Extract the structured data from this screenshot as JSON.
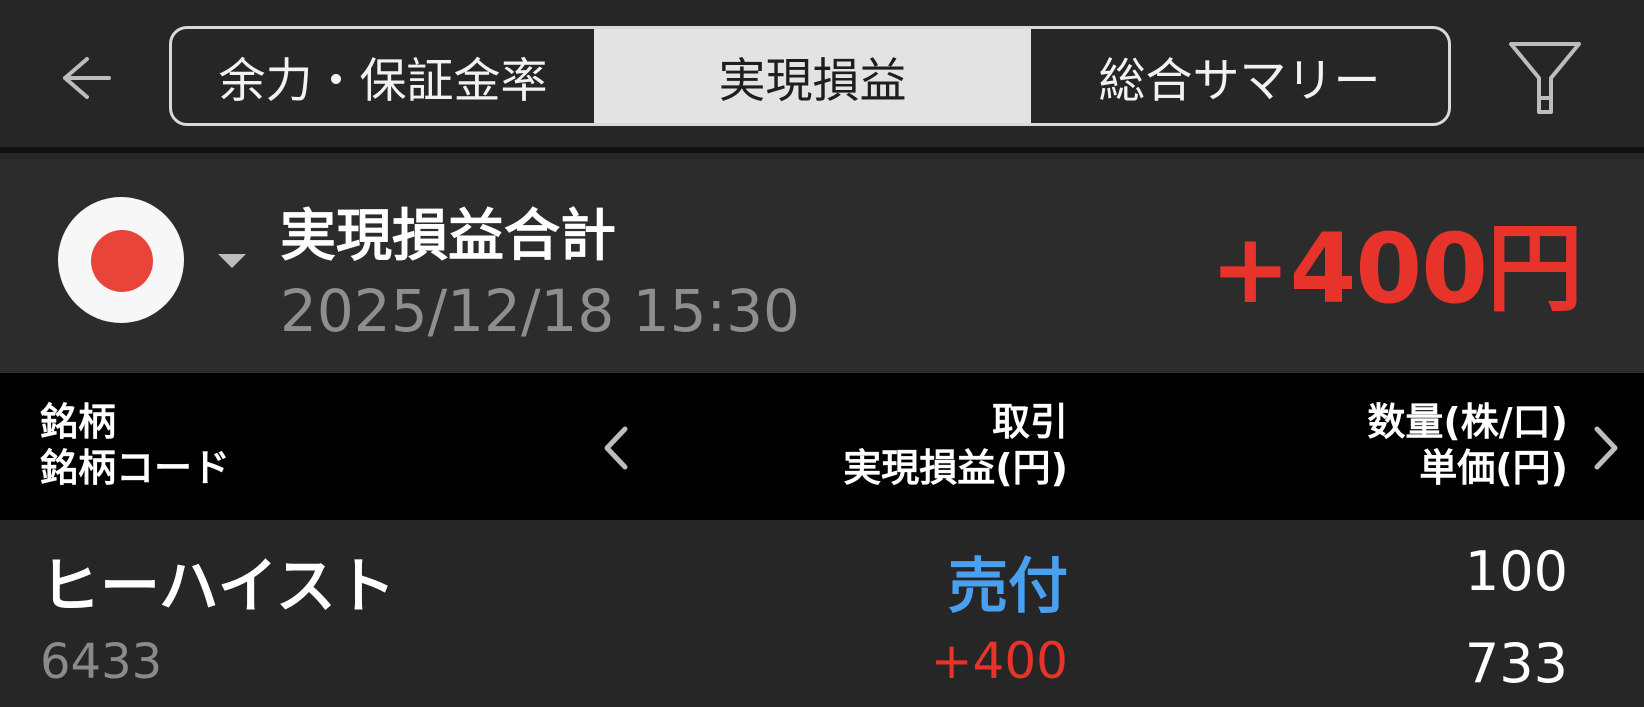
{
  "header": {
    "tabs": [
      {
        "label": "余力・保証金率",
        "active": false
      },
      {
        "label": "実現損益",
        "active": true
      },
      {
        "label": "総合サマリー",
        "active": false
      }
    ],
    "back_icon": "arrow-left-icon",
    "filter_icon": "filter-icon"
  },
  "summary": {
    "market_icon": "japan-flag-icon",
    "title": "実現損益合計",
    "datetime": "2025/12/18  15:30",
    "total": "+400円"
  },
  "table": {
    "columns": {
      "left": [
        "銘柄",
        "銘柄コード"
      ],
      "mid": [
        "取引",
        "実現損益(円)"
      ],
      "right": [
        "数量(株/口)",
        "単価(円)"
      ]
    },
    "rows": [
      {
        "name": "ヒーハイスト",
        "code": "6433",
        "trade": "売付",
        "pnl": "+400",
        "quantity": "100",
        "unit_price": "733"
      }
    ]
  },
  "colors": {
    "background": "#262626",
    "profit_red": "#e8332a",
    "sell_blue": "#4aa0f0",
    "header_black": "#000000",
    "muted_gray": "#8e8e8e"
  }
}
